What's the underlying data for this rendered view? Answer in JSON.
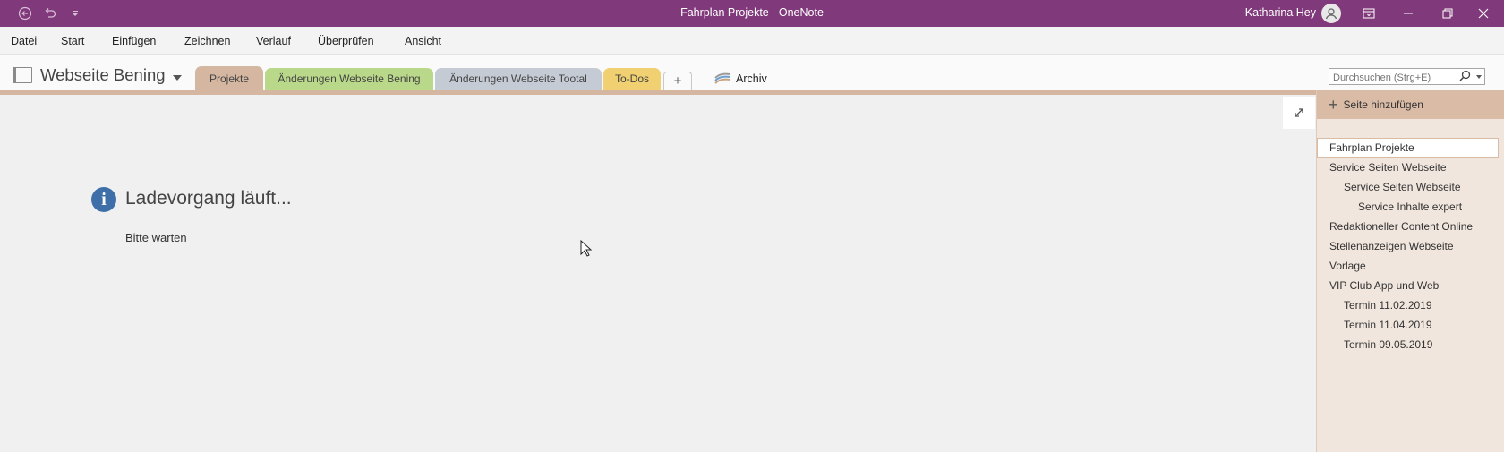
{
  "titlebar": {
    "title": "Fahrplan Projekte  -  OneNote",
    "user": "Katharina Hey",
    "back_icon": "back-arrow-icon",
    "undo_icon": "undo-icon",
    "customize_icon": "customize-quick-access-icon"
  },
  "menu": [
    "Datei",
    "Start",
    "Einfügen",
    "Zeichnen",
    "Verlauf",
    "Überprüfen",
    "Ansicht"
  ],
  "notebook": {
    "title": "Webseite Bening"
  },
  "tabs": [
    {
      "label": "Projekte",
      "color": "#d5b6a1",
      "active": true
    },
    {
      "label": "Änderungen Webseite Bening",
      "color": "#b9d889"
    },
    {
      "label": "Änderungen Webseite Tootal",
      "color": "#c5cbd4"
    },
    {
      "label": "To-Dos",
      "color": "#f0d070"
    }
  ],
  "add_tab_label": "+",
  "archiv_label": "Archiv",
  "search": {
    "placeholder": "Durchsuchen (Strg+E)"
  },
  "loading": {
    "title": "Ladevorgang läuft...",
    "subtitle": "Bitte warten"
  },
  "page_pane": {
    "add_label": "Seite hinzufügen",
    "pages": [
      {
        "label": "Fahrplan Projekte",
        "level": 0,
        "selected": true
      },
      {
        "label": "Service Seiten Webseite",
        "level": 0
      },
      {
        "label": "Service Seiten Webseite",
        "level": 1
      },
      {
        "label": "Service Inhalte expert",
        "level": 2
      },
      {
        "label": "Redaktioneller Content Online",
        "level": 0
      },
      {
        "label": "Stellenanzeigen Webseite",
        "level": 0
      },
      {
        "label": "Vorlage",
        "level": 0
      },
      {
        "label": "VIP Club App und Web",
        "level": 0
      },
      {
        "label": "Termin 11.02.2019",
        "level": 1
      },
      {
        "label": "Termin 11.04.2019",
        "level": 1
      },
      {
        "label": "Termin 09.05.2019",
        "level": 1
      }
    ]
  },
  "colors": {
    "titlebar": "#80397b",
    "section_accent": "#d5b6a1",
    "page_pane": "#f1e6de"
  }
}
